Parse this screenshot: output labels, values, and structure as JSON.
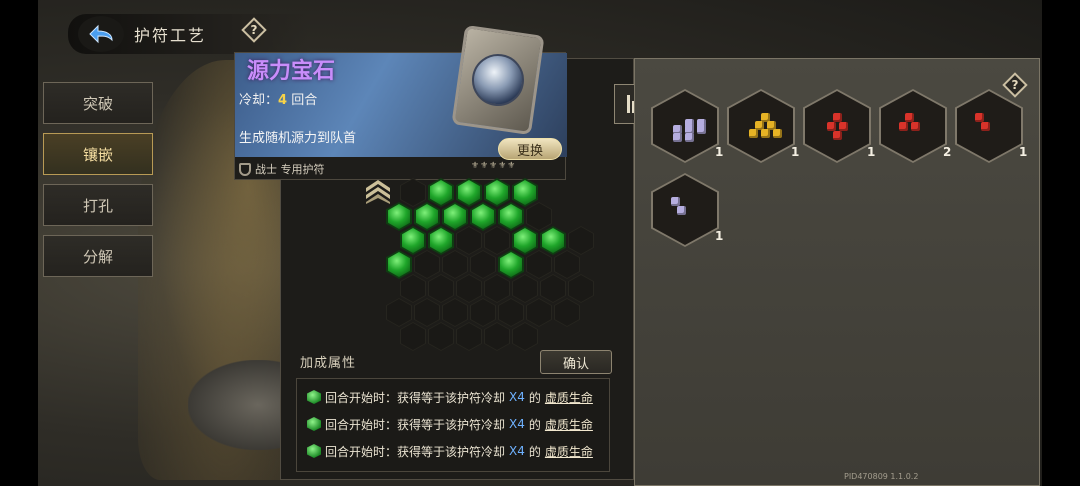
{
  "header": {
    "title": "护符工艺"
  },
  "side_menu": [
    {
      "label": "突破",
      "active": false
    },
    {
      "label": "镶嵌",
      "active": true
    },
    {
      "label": "打孔",
      "active": false
    },
    {
      "label": "分解",
      "active": false
    }
  ],
  "card": {
    "name": "源力宝石",
    "cooldown_label": "冷却：",
    "cooldown_value": "4",
    "cooldown_unit": " 回合",
    "description": "生成随机源力到队首",
    "class_label": "战士 专用护符",
    "swap_label": "更换",
    "rank_stars": 5
  },
  "hexgrid": {
    "filled": [
      [
        1,
        0
      ],
      [
        2,
        0
      ],
      [
        3,
        0
      ],
      [
        4,
        0
      ],
      [
        0,
        1
      ],
      [
        1,
        1
      ],
      [
        2,
        1
      ],
      [
        3,
        1
      ],
      [
        4,
        1
      ],
      [
        0,
        2
      ],
      [
        1,
        2
      ],
      [
        4,
        2
      ],
      [
        5,
        2
      ],
      [
        0,
        3
      ],
      [
        4,
        3
      ]
    ]
  },
  "attributes": {
    "title": "加成属性",
    "confirm_label": "确认",
    "rows": [
      {
        "prefix": "回合开始时：获得等于该护符冷却",
        "mult": "X4",
        "mid": "的",
        "keyword": "虚质生命"
      },
      {
        "prefix": "回合开始时：获得等于该护符冷却",
        "mult": "X4",
        "mid": "的",
        "keyword": "虚质生命"
      },
      {
        "prefix": "回合开始时：获得等于该护符冷却",
        "mult": "X4",
        "mid": "的",
        "keyword": "虚质生命"
      }
    ]
  },
  "inventory": [
    {
      "color": "#b6aee0",
      "count": "1",
      "cubes": 7
    },
    {
      "color": "#e6b325",
      "count": "1",
      "cubes": 6
    },
    {
      "color": "#d9332a",
      "count": "1",
      "cubes": 4
    },
    {
      "color": "#d9332a",
      "count": "2",
      "cubes": 3
    },
    {
      "color": "#d9332a",
      "count": "1",
      "cubes": 2
    },
    {
      "color": "#b6aee0",
      "count": "1",
      "cubes": 2
    }
  ],
  "footer": {
    "pid": "PID470809  1.1.0.2"
  }
}
